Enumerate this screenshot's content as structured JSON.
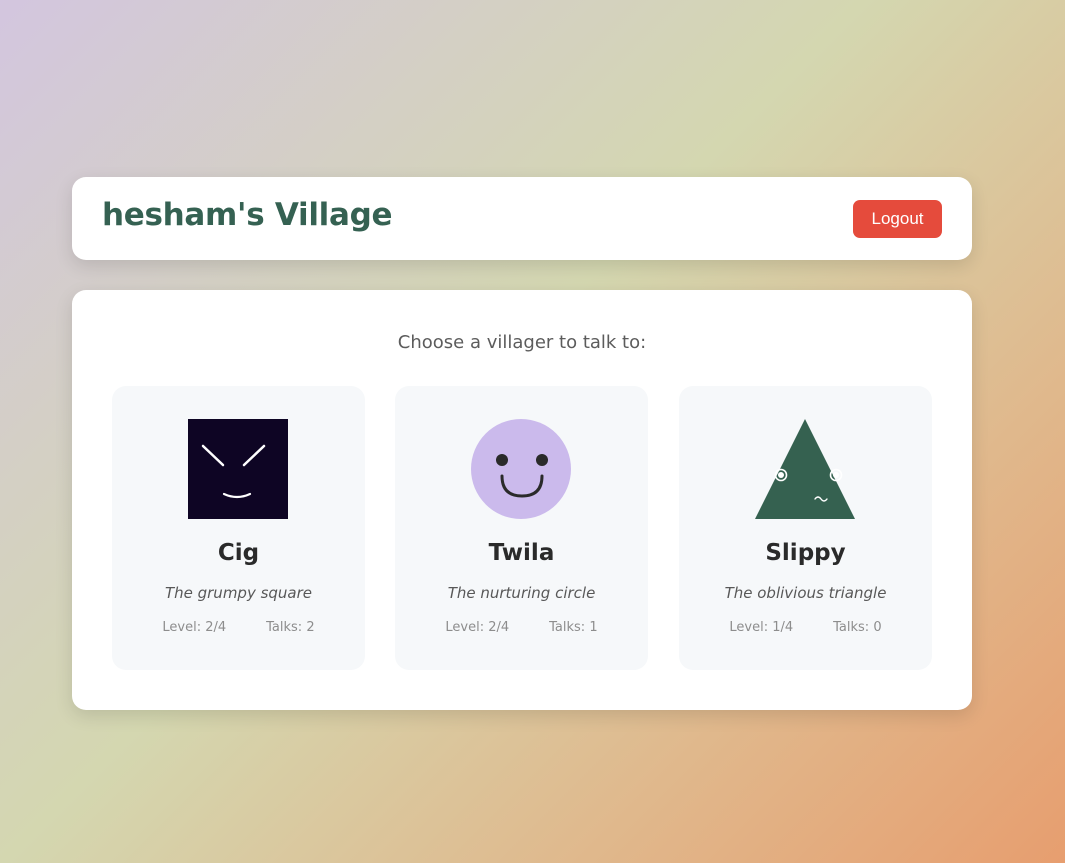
{
  "header": {
    "title": "hesham's Village",
    "logout_label": "Logout"
  },
  "main": {
    "prompt": "Choose a villager to talk to:"
  },
  "villagers": [
    {
      "name": "Cig",
      "description": "The grumpy square",
      "level": "Level: 2/4",
      "talks": "Talks: 2",
      "shape": "square",
      "icon": "grumpy-square-face-icon",
      "color": "#0e0524"
    },
    {
      "name": "Twila",
      "description": "The nurturing circle",
      "level": "Level: 2/4",
      "talks": "Talks: 1",
      "shape": "circle",
      "icon": "smiling-circle-face-icon",
      "color": "#cbbaec"
    },
    {
      "name": "Slippy",
      "description": "The oblivious triangle",
      "level": "Level: 1/4",
      "talks": "Talks: 0",
      "shape": "triangle",
      "icon": "oblivious-triangle-face-icon",
      "color": "#356150"
    }
  ],
  "colors": {
    "accent": "#356152",
    "logout": "#e54b3c"
  }
}
